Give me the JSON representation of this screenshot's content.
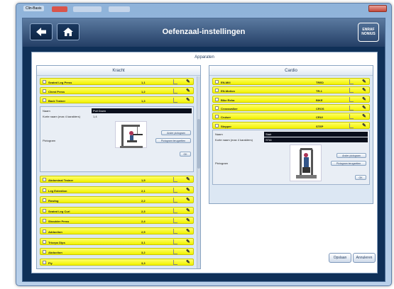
{
  "window": {
    "title": "Clin-Basis"
  },
  "header": {
    "title": "Oefenzaal-instellingen",
    "logo_line1": "ENRAF",
    "logo_line2": "NONIUS"
  },
  "section": {
    "title": "Apparaten"
  },
  "kracht": {
    "title": "Kracht",
    "items_top": [
      {
        "name": "Seated Leg Press",
        "code": "1,1"
      },
      {
        "name": "Chest Press",
        "code": "1,2"
      },
      {
        "name": "Back Trainer",
        "code": "1,3"
      }
    ],
    "detail": {
      "name_label": "Naam",
      "name_value": "Pull Down",
      "short_label": "Korte naam (max 4 karakters)",
      "short_value": "1,4",
      "picto_label": "Pictogram",
      "btn_change": "Ander pictogram",
      "btn_default": "Pictogram terugzetten",
      "btn_ok": "OK"
    },
    "items_bottom": [
      {
        "name": "Abdominal Trainer",
        "code": "1,5"
      },
      {
        "name": "Leg Extention",
        "code": "2,1"
      },
      {
        "name": "Rowing",
        "code": "2,2"
      },
      {
        "name": "Seated Leg Curl",
        "code": "2,3"
      },
      {
        "name": "Shoulder Press",
        "code": "2,4"
      },
      {
        "name": "Adduction",
        "code": "2,5"
      },
      {
        "name": "Triceps Dips",
        "code": "3,1"
      },
      {
        "name": "Abduction",
        "code": "3,2"
      },
      {
        "name": "Fly",
        "code": "3,3"
      }
    ]
  },
  "cardio": {
    "title": "Cardio",
    "items": [
      {
        "name": "EN-Mill",
        "code": "TRED"
      },
      {
        "name": "EN-Motion",
        "code": "TR-1"
      },
      {
        "name": "Bike Reha",
        "code": "BIKE"
      },
      {
        "name": "Crosswalker",
        "code": "CROS"
      },
      {
        "name": "Cruiser",
        "code": "CRUI"
      },
      {
        "name": "Stepper",
        "code": "STEP"
      }
    ],
    "detail": {
      "name_label": "Naam",
      "name_value": "Stair",
      "short_label": "Korte naam (max 4 karakters)",
      "short_value": "STAI",
      "picto_label": "Pictogram",
      "btn_change": "Ander pictogram",
      "btn_default": "Pictogram terugzetten",
      "btn_ok": "OK"
    }
  },
  "footer": {
    "save": "Opslaan",
    "cancel": "Annuleren"
  },
  "colors": {
    "row_yellow": "#f2f200",
    "app_bg": "#0f3058",
    "panel_bg": "#dce7f3"
  },
  "icons": [
    "back-arrow-icon",
    "home-icon",
    "pencil-icon",
    "checkbox-icon",
    "machine-icon"
  ]
}
